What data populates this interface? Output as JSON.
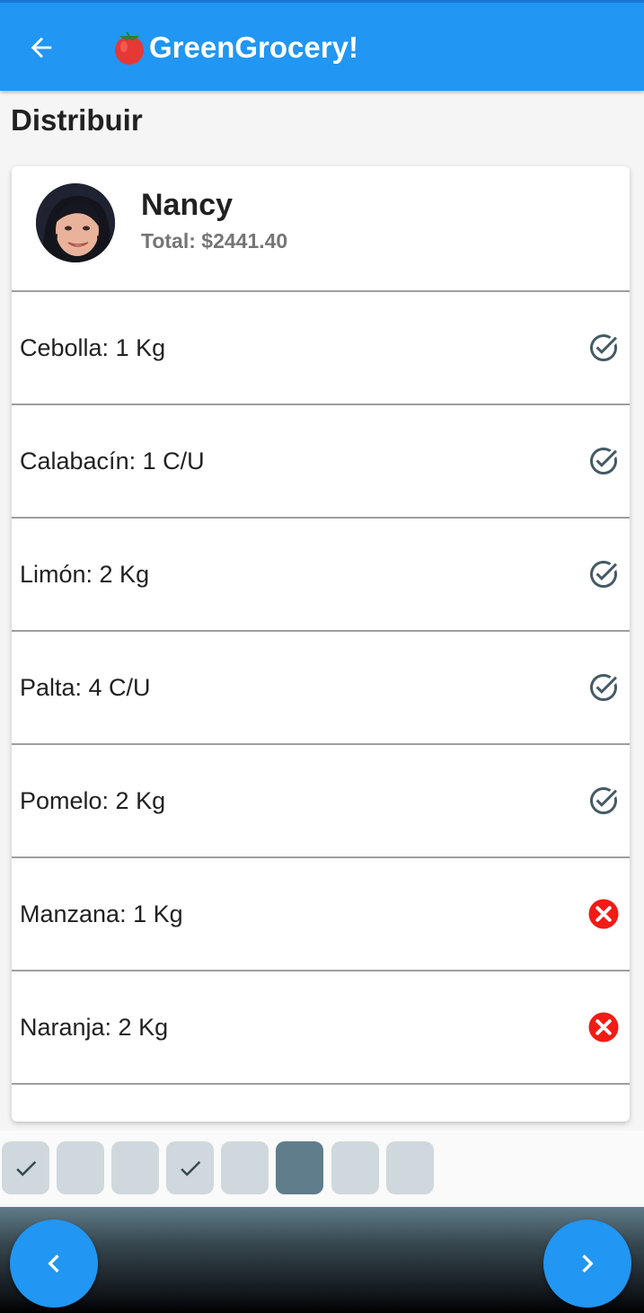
{
  "app": {
    "title": "GreenGrocery!",
    "accent_color": "#2196f3"
  },
  "page": {
    "heading": "Distribuir"
  },
  "customer": {
    "name": "Nancy",
    "total": "Total: $2441.40"
  },
  "items": [
    {
      "label": "Cebolla: 1 Kg",
      "status": "done",
      "icon": "check-circle-icon"
    },
    {
      "label": "Calabacín: 1 C/U",
      "status": "done",
      "icon": "check-circle-icon"
    },
    {
      "label": "Limón: 2 Kg",
      "status": "done",
      "icon": "check-circle-icon"
    },
    {
      "label": "Palta: 4 C/U",
      "status": "done",
      "icon": "check-circle-icon"
    },
    {
      "label": "Pomelo: 2 Kg",
      "status": "done",
      "icon": "check-circle-icon"
    },
    {
      "label": "Manzana: 1 Kg",
      "status": "missing",
      "icon": "error-circle-icon"
    },
    {
      "label": "Naranja: 2 Kg",
      "status": "missing",
      "icon": "error-circle-icon"
    }
  ],
  "steps": [
    {
      "state": "completed"
    },
    {
      "state": "pending"
    },
    {
      "state": "pending"
    },
    {
      "state": "completed"
    },
    {
      "state": "pending"
    },
    {
      "state": "current"
    },
    {
      "state": "pending"
    },
    {
      "state": "pending"
    }
  ],
  "colors": {
    "done_icon": "#455a64",
    "missing_icon": "#f21b16",
    "step_active": "#607d8b",
    "step_idle": "#cfd8dc"
  }
}
